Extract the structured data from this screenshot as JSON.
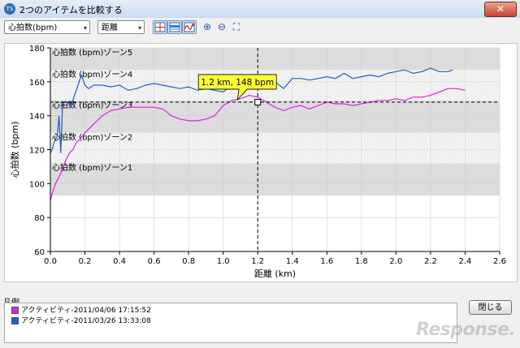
{
  "window": {
    "title": "2つのアイテムを比較する",
    "app_icon_text": "TS",
    "close_glyph": "✕"
  },
  "toolbar": {
    "metric_select": "心拍数(bpm)",
    "axis_select": "距離",
    "select_arrow": "▾",
    "zoom_in_glyph": "⊕",
    "zoom_out_glyph": "⊖",
    "fit_glyph": "⛶"
  },
  "legend": {
    "label": "凡例",
    "items": [
      {
        "label": "アクティビティ-2011/04/06 17:15:52",
        "color": "#e020e0"
      },
      {
        "label": "アクティビティ-2011/03/26 13:33:08",
        "color": "#2060c0"
      }
    ]
  },
  "buttons": {
    "close": "閉じる"
  },
  "watermark": "Response.",
  "chart_data": {
    "type": "line",
    "xlabel": "距離 (km)",
    "ylabel": "心拍数 (bpm)",
    "xlim": [
      0,
      2.6
    ],
    "ylim": [
      60,
      180
    ],
    "x_ticks": [
      "0.0",
      "0.2",
      "0.4",
      "0.6",
      "0.8",
      "1.0",
      "1.2",
      "1.4",
      "1.6",
      "1.8",
      "2.0",
      "2.2",
      "2.4",
      "2.6"
    ],
    "y_ticks": [
      "60",
      "80",
      "100",
      "120",
      "140",
      "160",
      "180"
    ],
    "grid": true,
    "zones": [
      {
        "label": "心拍数 (bpm)ゾーン1",
        "from": 93,
        "to": 112
      },
      {
        "label": "心拍数 (bpm)ゾーン2",
        "from": 112,
        "to": 130
      },
      {
        "label": "心拍数 (bpm)ゾーン3",
        "from": 130,
        "to": 149
      },
      {
        "label": "心拍数 (bpm)ゾーン4",
        "from": 149,
        "to": 167
      },
      {
        "label": "心拍数 (bpm)ゾーン5",
        "from": 167,
        "to": 180
      }
    ],
    "cursor": {
      "x": 1.2,
      "y": 148,
      "label": "1.2 km, 148 bpm"
    },
    "series": [
      {
        "name": "アクティビティ-2011/04/06 17:15:52",
        "color": "#e020e0",
        "x": [
          0.0,
          0.01,
          0.03,
          0.05,
          0.07,
          0.09,
          0.11,
          0.13,
          0.15,
          0.17,
          0.2,
          0.23,
          0.26,
          0.3,
          0.35,
          0.4,
          0.45,
          0.5,
          0.55,
          0.6,
          0.65,
          0.7,
          0.75,
          0.8,
          0.85,
          0.9,
          0.95,
          1.0,
          1.05,
          1.1,
          1.15,
          1.2,
          1.25,
          1.3,
          1.35,
          1.4,
          1.45,
          1.5,
          1.55,
          1.6,
          1.65,
          1.7,
          1.75,
          1.8,
          1.85,
          1.9,
          1.95,
          2.0,
          2.05,
          2.1,
          2.15,
          2.2,
          2.25,
          2.3,
          2.35,
          2.4
        ],
        "y": [
          90,
          94,
          100,
          104,
          108,
          114,
          118,
          120,
          124,
          126,
          130,
          133,
          136,
          140,
          143,
          144,
          145,
          145,
          145,
          145,
          144,
          140,
          138,
          137,
          137,
          138,
          140,
          146,
          149,
          150,
          152,
          151,
          148,
          145,
          143,
          145,
          146,
          144,
          146,
          148,
          147,
          147,
          146,
          147,
          148,
          149,
          149,
          150,
          149,
          151,
          151,
          152,
          154,
          156,
          156,
          155
        ]
      },
      {
        "name": "アクティビティ-2011/03/26 13:33:08",
        "color": "#2060c0",
        "x": [
          0.0,
          0.01,
          0.02,
          0.04,
          0.05,
          0.06,
          0.07,
          0.08,
          0.1,
          0.12,
          0.14,
          0.16,
          0.18,
          0.2,
          0.22,
          0.25,
          0.3,
          0.35,
          0.4,
          0.45,
          0.5,
          0.55,
          0.6,
          0.65,
          0.7,
          0.75,
          0.8,
          0.85,
          0.9,
          0.95,
          1.0,
          1.05,
          1.1,
          1.15,
          1.2,
          1.25,
          1.3,
          1.35,
          1.4,
          1.45,
          1.5,
          1.55,
          1.6,
          1.65,
          1.7,
          1.75,
          1.8,
          1.85,
          1.9,
          1.95,
          2.0,
          2.05,
          2.1,
          2.15,
          2.2,
          2.25,
          2.3,
          2.33
        ],
        "y": [
          118,
          120,
          124,
          128,
          140,
          118,
          146,
          148,
          148,
          146,
          152,
          158,
          164,
          158,
          156,
          158,
          158,
          157,
          158,
          155,
          156,
          158,
          159,
          158,
          157,
          156,
          157,
          155,
          156,
          155,
          154,
          158,
          160,
          158,
          157,
          158,
          160,
          156,
          162,
          162,
          161,
          162,
          163,
          162,
          165,
          162,
          163,
          164,
          163,
          165,
          166,
          167,
          165,
          166,
          168,
          166,
          166,
          167
        ]
      }
    ]
  }
}
